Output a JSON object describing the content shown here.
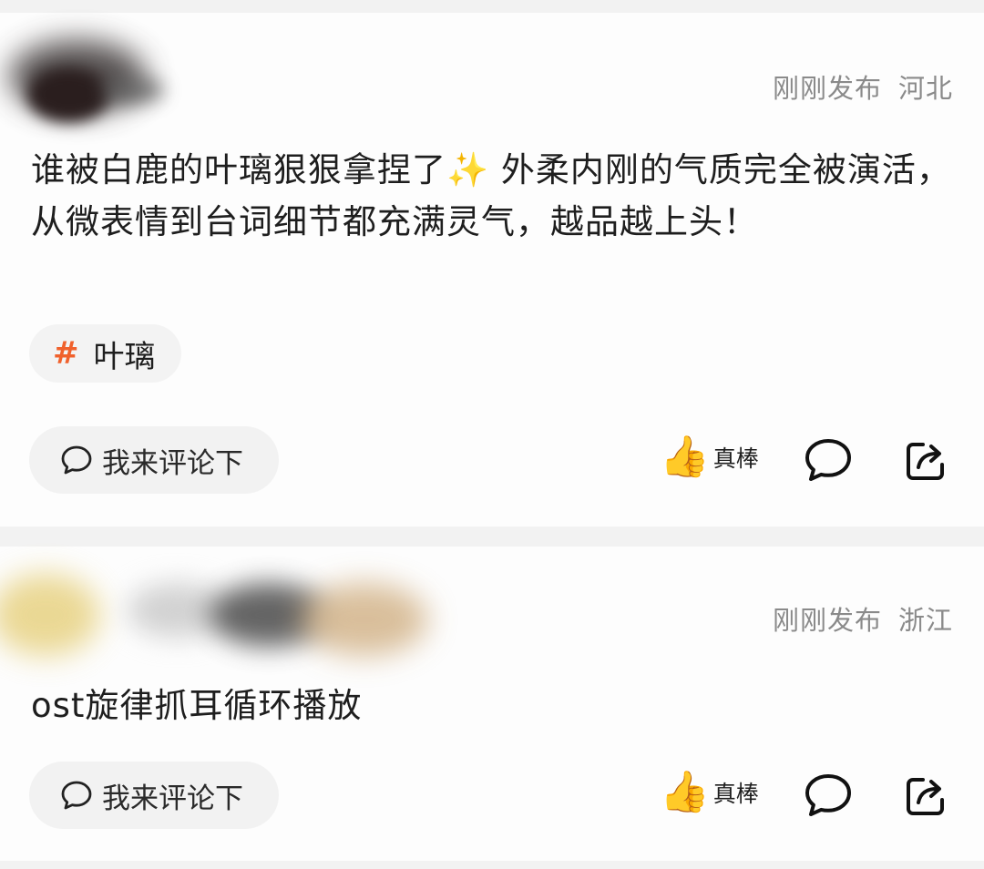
{
  "posts": [
    {
      "meta": {
        "time": "刚刚发布",
        "location": "河北"
      },
      "text": "谁被白鹿的叶璃狠狠拿捏了✨ 外柔内刚的气质完全被演活，从微表情到台词细节都充满灵气，越品越上头！",
      "topic": {
        "hash": "#",
        "label": "叶璃"
      },
      "actions": {
        "comment_placeholder": "我来评论下",
        "like_emoji": "👍",
        "like_label": "真棒",
        "comment_icon": "speech-bubble-icon",
        "share_icon": "share-icon"
      }
    },
    {
      "meta": {
        "time": "刚刚发布",
        "location": "浙江"
      },
      "text": "ost旋律抓耳循环播放",
      "actions": {
        "comment_placeholder": "我来评论下",
        "like_emoji": "👍",
        "like_label": "真棒",
        "comment_icon": "speech-bubble-icon",
        "share_icon": "share-icon"
      }
    }
  ]
}
